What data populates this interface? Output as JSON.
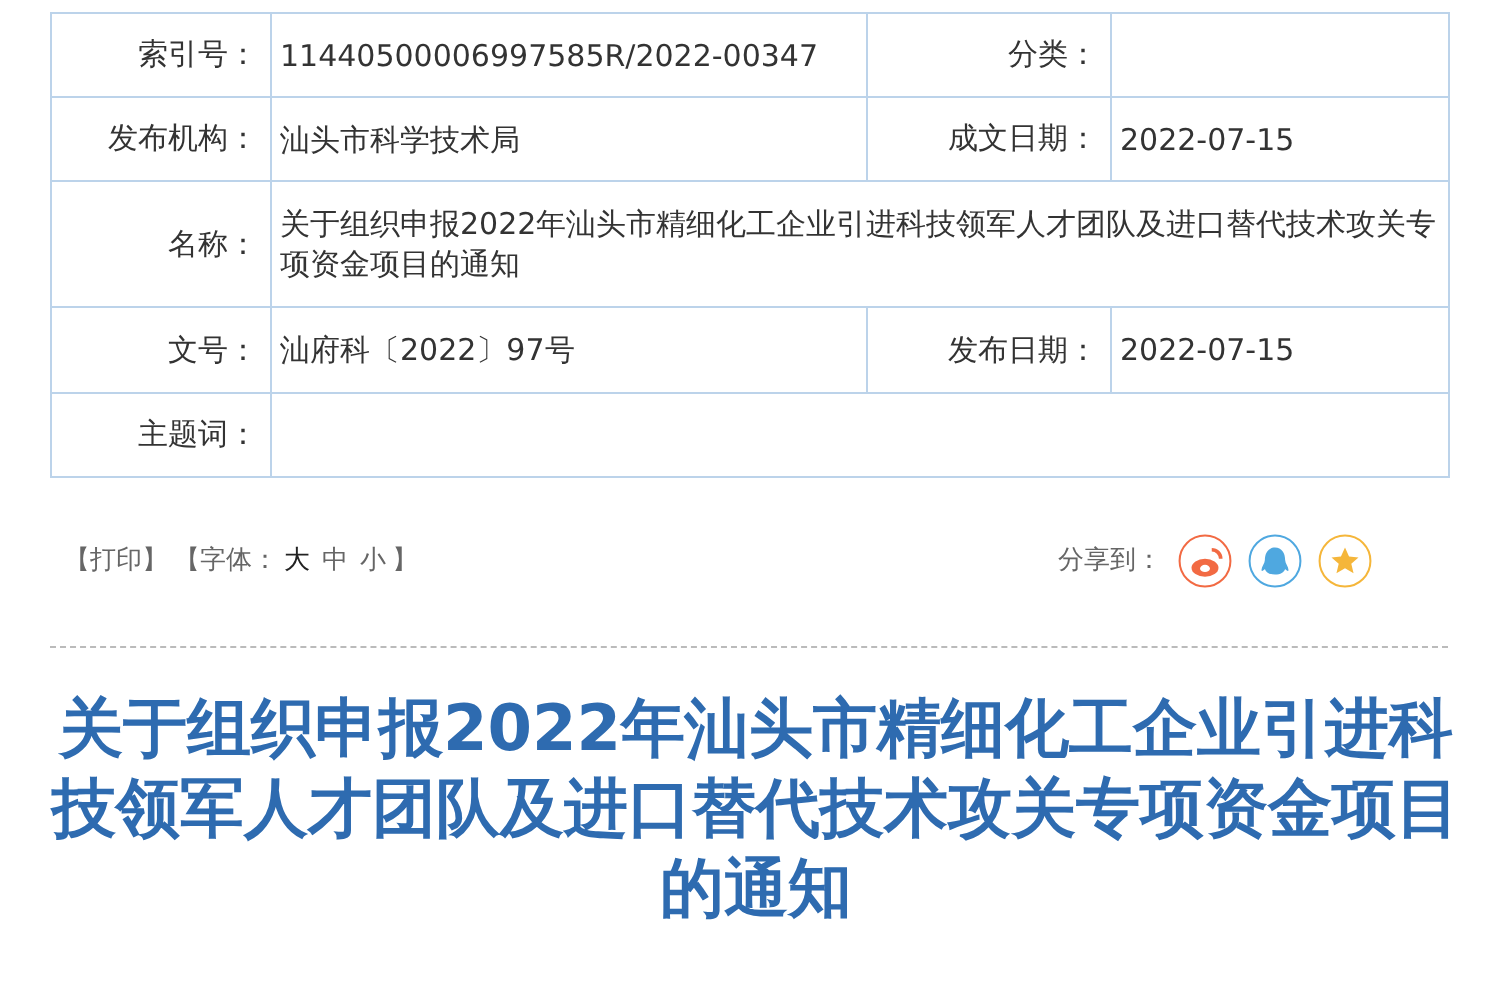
{
  "meta_rows": [
    {
      "fields": [
        {
          "label": "索引号：",
          "value": "11440500006997585R/2022-00347"
        },
        {
          "label": "分类："
        }
      ]
    },
    {
      "fields": [
        {
          "label": "发布机构：",
          "value": "汕头市科学技术局"
        },
        {
          "label": "成文日期：",
          "value": "2022-07-15"
        }
      ]
    },
    {
      "fields": [
        {
          "label": "名称：",
          "value": "关于组织申报2022年汕头市精细化工企业引进科技领军人才团队及进口替代技术攻关专项资金项目的通知"
        }
      ]
    },
    {
      "fields": [
        {
          "label": "文号：",
          "value": "汕府科〔2022〕97号"
        },
        {
          "label": "发布日期：",
          "value": "2022-07-15"
        }
      ]
    },
    {
      "fields": [
        {
          "label": "主题词："
        }
      ]
    }
  ],
  "toolbar": {
    "print_link": "【打印】",
    "font_prefix": "【字体：",
    "font_sizes": [
      {
        "label": "大",
        "selected": true
      },
      {
        "label": "中",
        "selected": false
      },
      {
        "label": "小",
        "selected": false
      }
    ],
    "font_suffix": "】"
  },
  "share": {
    "label": "分享到：",
    "targets": [
      {
        "kind": "weibo",
        "color": "#f26a43"
      },
      {
        "kind": "qq",
        "color": "#4fa8e0"
      },
      {
        "kind": "favorite",
        "color": "#f5b63a"
      }
    ]
  },
  "title": "关于组织申报2022年汕头市精细化工企业引进科技领军人才团队及进口替代技术攻关专项资金项目的通知"
}
